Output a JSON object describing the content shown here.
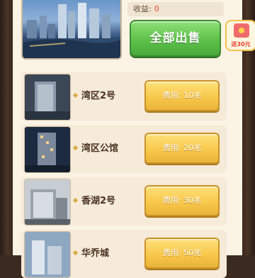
{
  "header": {
    "income_label": "收益:",
    "income_value": "0",
    "sell_all_label": "全部出售",
    "bonus_tag": "送30元"
  },
  "properties": [
    {
      "name": "湾区2号",
      "cost": "费用: 10兆"
    },
    {
      "name": "湾区公馆",
      "cost": "费用: 20兆"
    },
    {
      "name": "香湖2号",
      "cost": "费用: 30兆"
    },
    {
      "name": "华乔城",
      "cost": "费用: 50兆"
    }
  ],
  "colors": {
    "panel": "#fbf3e4",
    "row": "#f6ead8",
    "sell_green": "#5ec24b",
    "cost_gold": "#f7c648",
    "income_red": "#e2442f"
  }
}
